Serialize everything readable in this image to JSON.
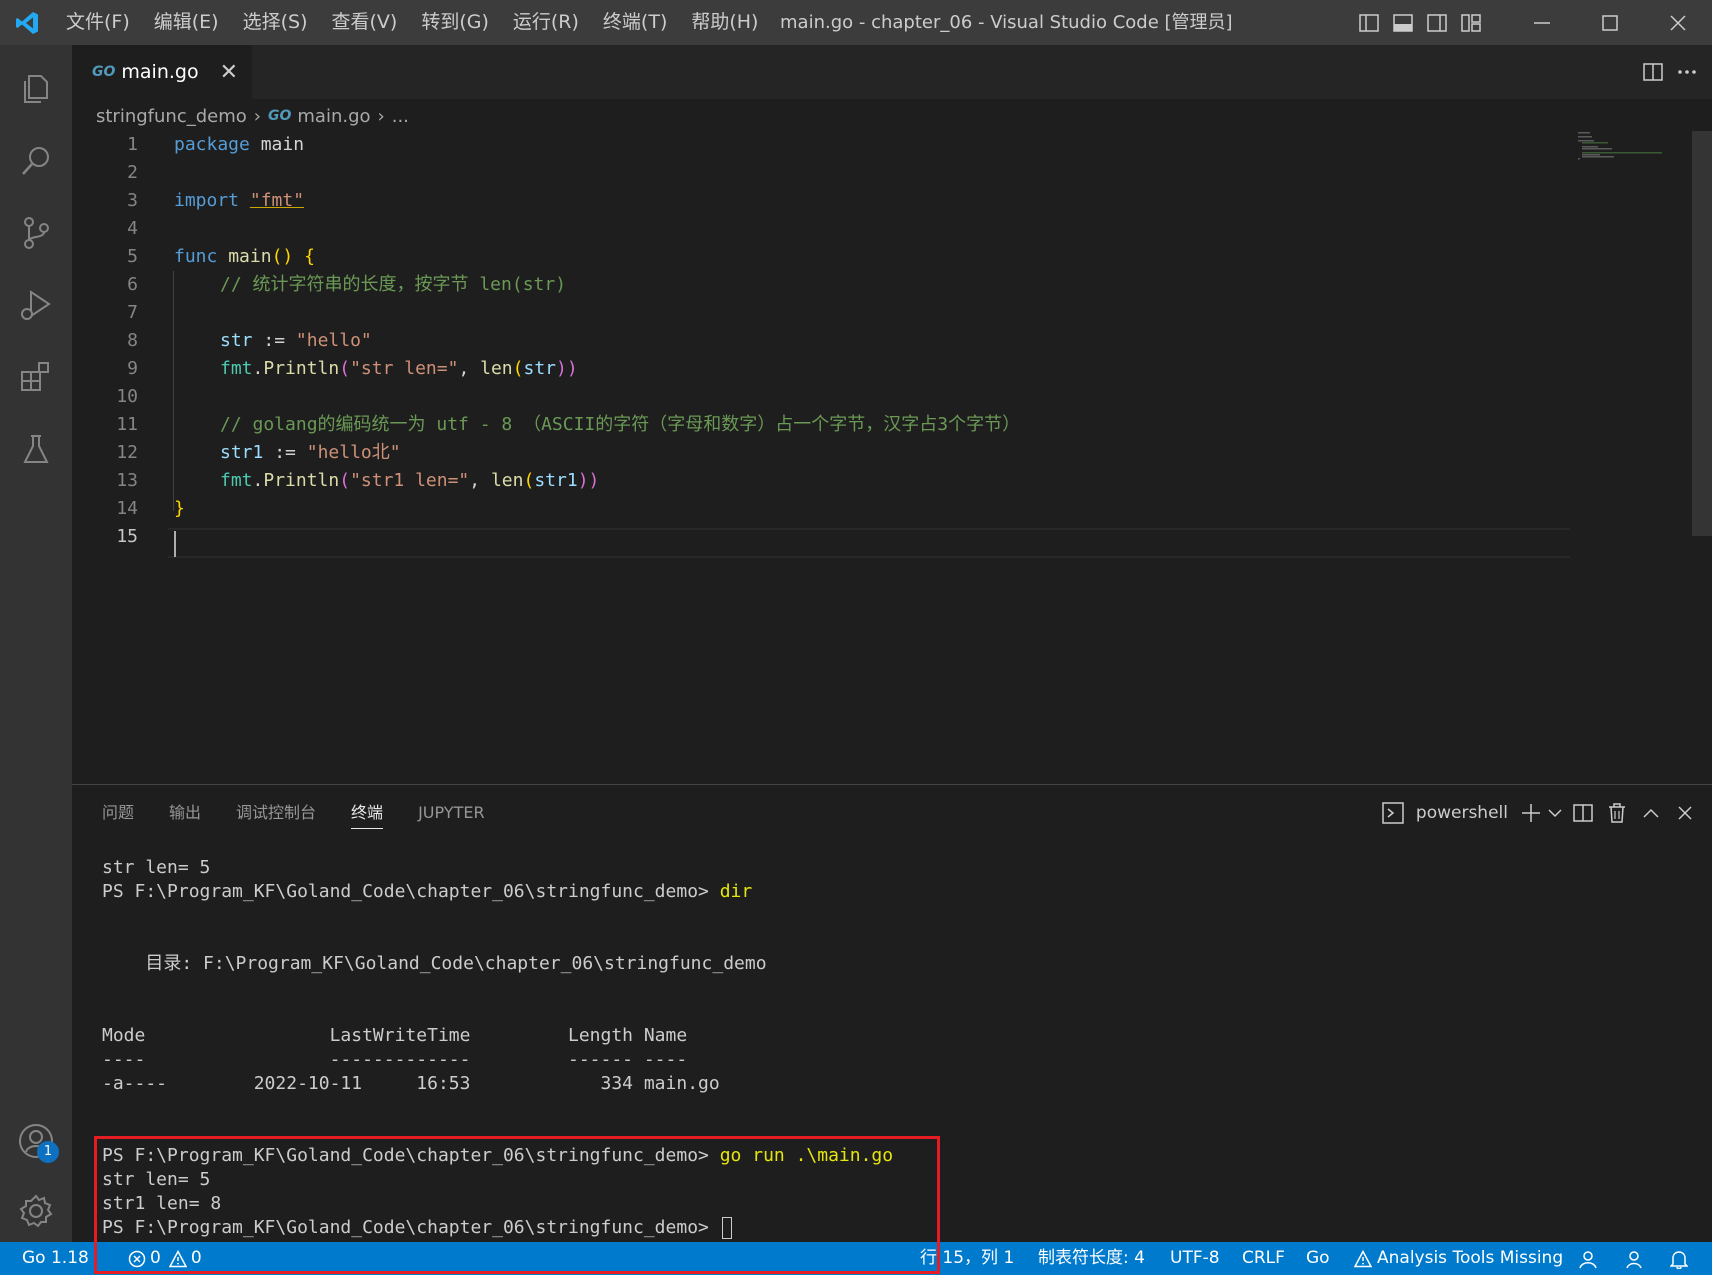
{
  "titlebar": {
    "menu": [
      "文件(F)",
      "编辑(E)",
      "选择(S)",
      "查看(V)",
      "转到(G)",
      "运行(R)",
      "终端(T)",
      "帮助(H)"
    ],
    "title": "main.go - chapter_06 - Visual Studio Code [管理员]"
  },
  "activitybar": {
    "items": [
      "explorer-icon",
      "search-icon",
      "source-control-icon",
      "run-debug-icon",
      "extensions-icon",
      "testing-icon"
    ],
    "accounts_badge": "1"
  },
  "editor": {
    "tab": {
      "glyph": "GO",
      "label": "main.go",
      "close": "✕"
    },
    "breadcrumb": {
      "folder": "stringfunc_demo",
      "file": "main.go",
      "more": "..."
    },
    "line_numbers": [
      "1",
      "2",
      "3",
      "4",
      "5",
      "6",
      "7",
      "8",
      "9",
      "10",
      "11",
      "12",
      "13",
      "14",
      "15"
    ],
    "code": {
      "l1a": "package",
      "l1b": "main",
      "l3a": "import",
      "l3b": "\"fmt\"",
      "l5a": "func",
      "l5b": "main",
      "l5c": "()",
      "l5d": "{",
      "l6": "// 统计字符串的长度，按字节 len(str)",
      "l8a": "str",
      "l8b": ":=",
      "l8c": "\"hello\"",
      "l9a": "fmt",
      "l9b": "Println",
      "l9c": "(",
      "l9d": "\"str len=\"",
      "l9e": ", ",
      "l9f": "len",
      "l9g": "(",
      "l9h": "str",
      "l9i": "))",
      "l11": "// golang的编码统一为 utf - 8 （ASCII的字符（字母和数字）占一个字节，汉字占3个字节）",
      "l12a": "str1",
      "l12b": ":=",
      "l12c": "\"hello北\"",
      "l13a": "fmt",
      "l13b": "Println",
      "l13c": "(",
      "l13d": "\"str1 len=\"",
      "l13e": ", ",
      "l13f": "len",
      "l13g": "(",
      "l13h": "str1",
      "l13i": "))",
      "l14": "}"
    }
  },
  "panel": {
    "tabs": [
      "问题",
      "输出",
      "调试控制台",
      "终端",
      "JUPYTER"
    ],
    "active_tab": "终端",
    "shell": "powershell",
    "terminal": {
      "t1": "str len= 5",
      "t2_prompt": "PS F:\\Program_KF\\Goland_Code\\chapter_06\\stringfunc_demo> ",
      "t2_cmd": "dir",
      "t3": "    目录: F:\\Program_KF\\Goland_Code\\chapter_06\\stringfunc_demo",
      "t4": "Mode                 LastWriteTime         Length Name",
      "t5": "----                 -------------         ------ ----",
      "t6": "-a----        2022-10-11     16:53            334 main.go",
      "t7_prompt": "PS F:\\Program_KF\\Goland_Code\\chapter_06\\stringfunc_demo> ",
      "t7_cmd": "go run .\\main.go",
      "t8": "str len= 5",
      "t9": "str1 len= 8",
      "t10_prompt": "PS F:\\Program_KF\\Goland_Code\\chapter_06\\stringfunc_demo> "
    }
  },
  "statusbar": {
    "go_version": "Go 1.18",
    "errors": "0",
    "warnings": "0",
    "position": "行 15，列 1",
    "tab_size": "制表符长度: 4",
    "encoding": "UTF-8",
    "eol": "CRLF",
    "language": "Go",
    "analysis": "Analysis Tools Missing"
  },
  "colors": {
    "accent": "#007acc",
    "highlight_box": "#e51c23"
  }
}
